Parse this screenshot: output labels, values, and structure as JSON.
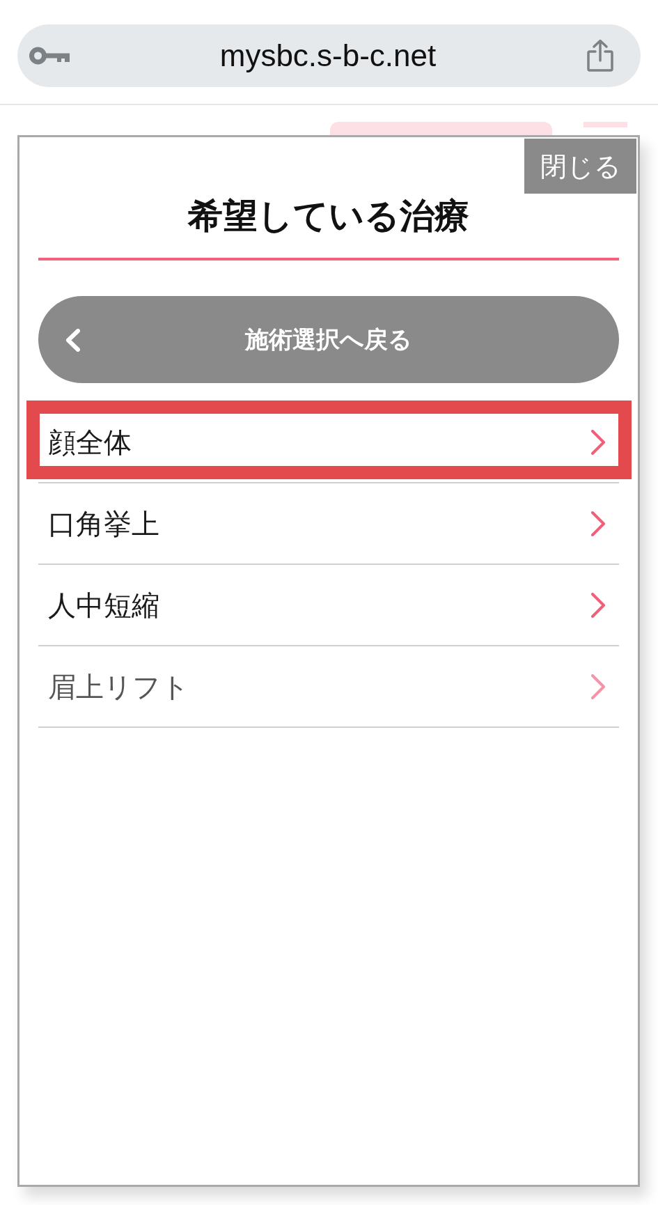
{
  "browser": {
    "url": "mysbc.s-b-c.net"
  },
  "modal": {
    "close_label": "閉じる",
    "title": "希望している治療",
    "back_button": "施術選択へ戻る",
    "items": [
      {
        "label": "顔全体",
        "highlighted": true,
        "dimmed": false
      },
      {
        "label": "口角挙上",
        "highlighted": false,
        "dimmed": false
      },
      {
        "label": "人中短縮",
        "highlighted": false,
        "dimmed": false
      },
      {
        "label": "眉上リフト",
        "highlighted": false,
        "dimmed": true
      }
    ]
  }
}
